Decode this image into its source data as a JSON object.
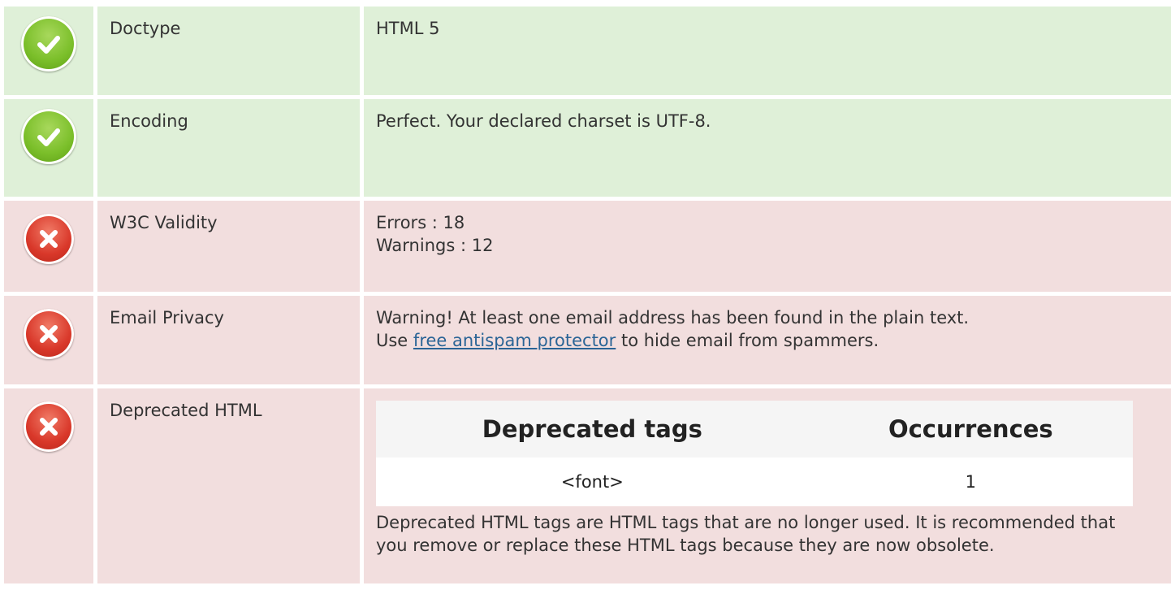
{
  "rows": [
    {
      "status": "pass",
      "label": "Doctype",
      "value_lines": [
        "HTML 5"
      ]
    },
    {
      "status": "pass",
      "label": "Encoding",
      "value_lines": [
        "Perfect. Your declared charset is UTF-8."
      ]
    },
    {
      "status": "fail",
      "label": "W3C Validity",
      "value_lines": [
        "Errors : 18",
        "Warnings : 12"
      ]
    },
    {
      "status": "fail",
      "label": "Email Privacy",
      "value_line1": "Warning! At least one email address has been found in the plain text.",
      "value_prefix": "Use ",
      "link_text": "free antispam protector",
      "value_suffix": " to hide email from spammers."
    },
    {
      "status": "fail",
      "label": "Deprecated HTML",
      "table": {
        "headers": [
          "Deprecated tags",
          "Occurrences"
        ],
        "rows": [
          [
            "<font>",
            "1"
          ]
        ]
      },
      "note": "Deprecated HTML tags are HTML tags that are no longer used. It is recommended that you remove or replace these HTML tags because they are now obsolete."
    }
  ],
  "icons": {
    "pass": "check-circle-icon",
    "fail": "x-circle-icon"
  },
  "colors": {
    "pass_bg": "#dff0d8",
    "fail_bg": "#f2dede",
    "link": "#2a6496"
  }
}
